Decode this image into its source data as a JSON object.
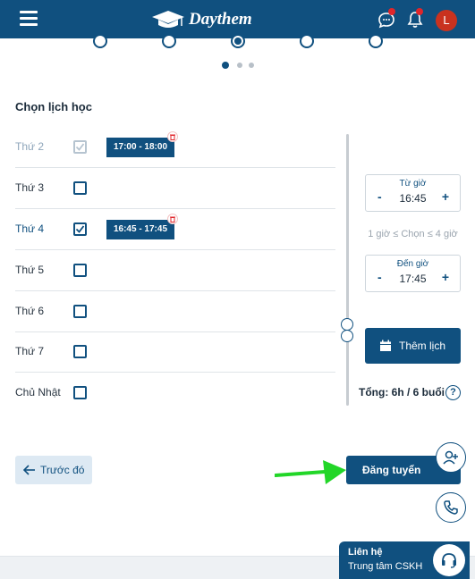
{
  "header": {
    "logo_text": "Daythem",
    "brand_color": "#10507f",
    "notification_color": "#e0262b",
    "avatar_initial": "L"
  },
  "stepper": {
    "steps": 5,
    "active_step": 3
  },
  "pager": {
    "pages": 3,
    "active_page": 1
  },
  "schedule": {
    "title": "Chọn lịch học",
    "days": [
      {
        "label": "Thứ 2",
        "checked": true,
        "disabled": true,
        "slot": "17:00 - 18:00"
      },
      {
        "label": "Thứ 3",
        "checked": false,
        "disabled": false,
        "slot": null
      },
      {
        "label": "Thứ 4",
        "checked": true,
        "disabled": false,
        "slot": "16:45 - 17:45"
      },
      {
        "label": "Thứ 5",
        "checked": false,
        "disabled": false,
        "slot": null
      },
      {
        "label": "Thứ 6",
        "checked": false,
        "disabled": false,
        "slot": null
      },
      {
        "label": "Thứ 7",
        "checked": false,
        "disabled": false,
        "slot": null
      },
      {
        "label": "Chủ Nhật",
        "checked": false,
        "disabled": false,
        "slot": null
      }
    ]
  },
  "time_picker": {
    "from_label": "Từ giờ",
    "from_value": "16:45",
    "to_label": "Đến giờ",
    "to_value": "17:45",
    "minus": "-",
    "plus": "+",
    "range_hint": "1 giờ ≤ Chọn ≤ 4 giờ",
    "add_label": "Thêm lịch"
  },
  "summary": {
    "total": "Tổng: 6h / 6 buổi",
    "help": "?"
  },
  "actions": {
    "back_label": "Trước đó",
    "submit_label": "Đăng tuyển"
  },
  "support": {
    "line1": "Liên hệ",
    "line2": "Trung tâm CSKH"
  },
  "icons": [
    "menu-icon",
    "graduation-cap-icon",
    "chat-icon",
    "bell-icon",
    "trash-icon",
    "check-icon",
    "calendar-icon",
    "arrow-left-icon",
    "add-user-icon",
    "phone-icon",
    "headset-icon",
    "help-icon"
  ]
}
